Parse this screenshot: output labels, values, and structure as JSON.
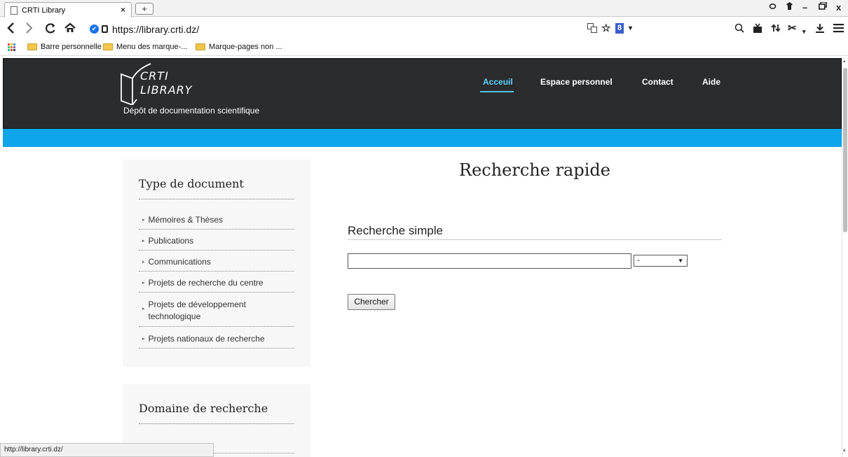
{
  "browser": {
    "tab": {
      "title": "CRTI Library",
      "close": "×"
    },
    "new_tab": "+",
    "window_controls": {
      "search": "⚲",
      "pin": "⬚",
      "minimize": "–",
      "restore": "🗗",
      "close": "x"
    },
    "url": "https://library.crti.dz/",
    "bookmarks": [
      {
        "label": "Barre personnelle"
      },
      {
        "label": "Menu des marque-..."
      },
      {
        "label": "Marque-pages non ..."
      }
    ],
    "status_url": "http://library.crti.dz/"
  },
  "site": {
    "logo_line1": "CRTI",
    "logo_line2": "LIBRARY",
    "tagline": "Dépôt de documentation scientifique",
    "menu": [
      {
        "label": "Acceuil",
        "active": true
      },
      {
        "label": "Espace personnel"
      },
      {
        "label": "Contact"
      },
      {
        "label": "Aide"
      }
    ],
    "colors": {
      "header_bg": "#2b2c2d",
      "band": "#0ea5ea",
      "active_link": "#5cd3ff"
    }
  },
  "sidebar": {
    "doc_type_title": "Type de document",
    "doc_types": [
      "Mémoires & Thèses",
      "Publications",
      "Communications",
      "Projets de recherche du centre",
      "Projets de développement technologique",
      "Projets nationaux de recherche"
    ],
    "domain_title": "Domaine de recherche"
  },
  "main": {
    "title": "Recherche rapide",
    "simple_title": "Recherche simple",
    "search_value": "",
    "select_value": "-",
    "button_label": "Chercher"
  }
}
